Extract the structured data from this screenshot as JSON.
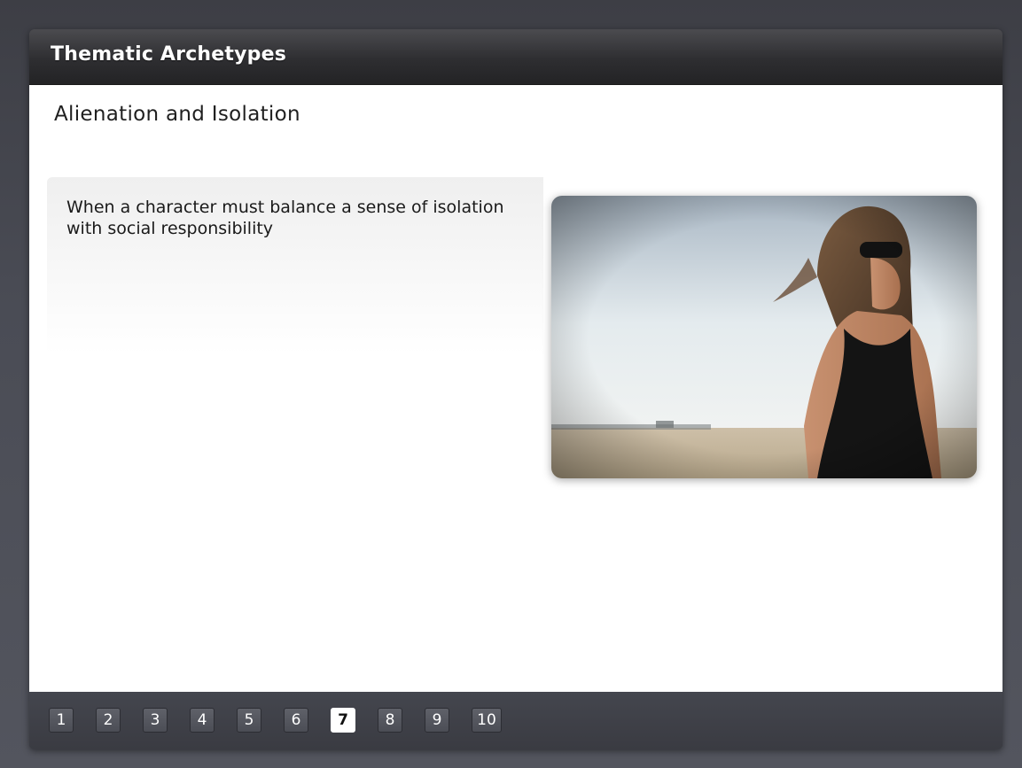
{
  "header": {
    "title": "Thematic Archetypes"
  },
  "slide": {
    "title": "Alienation and Isolation",
    "body": "When a character must balance a sense of isolation with social responsibility",
    "image_subject": "woman-in-sunglasses-on-beach"
  },
  "pager": {
    "pages": [
      "1",
      "2",
      "3",
      "4",
      "5",
      "6",
      "7",
      "8",
      "9",
      "10"
    ],
    "current": "7"
  },
  "colors": {
    "header_bg": "#2e2e31",
    "page_bg": "#44464e",
    "content_bg": "#ffffff",
    "active_page_bg": "#ffffff"
  }
}
